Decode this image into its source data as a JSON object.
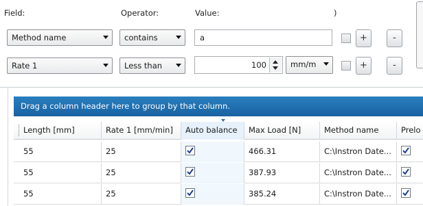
{
  "filter": {
    "headers": {
      "field": "Field:",
      "operator": "Operator:",
      "value": "Value:",
      "paren": ")"
    },
    "rows": [
      {
        "field": "Method name",
        "operator": "contains",
        "value": "a",
        "unit": "",
        "plus": "+",
        "minus": "-"
      },
      {
        "field": "Rate 1",
        "operator": "Less than",
        "value": "100",
        "unit": "mm/m",
        "plus": "+",
        "minus": "-"
      }
    ]
  },
  "grid": {
    "group_panel_text": "Drag a column header here to group by that column.",
    "columns": [
      "Length [mm]",
      "Rate 1 [mm/min]",
      "Auto balance",
      "Max Load [N]",
      "Method name",
      "Prelo"
    ],
    "rows": [
      {
        "length": "55",
        "rate": "25",
        "auto_balance": true,
        "max_load": "466.31",
        "method": "C:\\Instron Date...",
        "preload": true
      },
      {
        "length": "55",
        "rate": "25",
        "auto_balance": true,
        "max_load": "387.93",
        "method": "C:\\Instron Date...",
        "preload": true
      },
      {
        "length": "55",
        "rate": "25",
        "auto_balance": true,
        "max_load": "385.24",
        "method": "C:\\Instron Date...",
        "preload": true
      }
    ]
  },
  "icons": {
    "checkmark": "check-icon",
    "spin": "spinner-arrows-icon",
    "dropdown": "chevron-down-icon"
  },
  "colors": {
    "group_panel": "#1d6aaa",
    "selected_column": "#e6f1fb"
  }
}
